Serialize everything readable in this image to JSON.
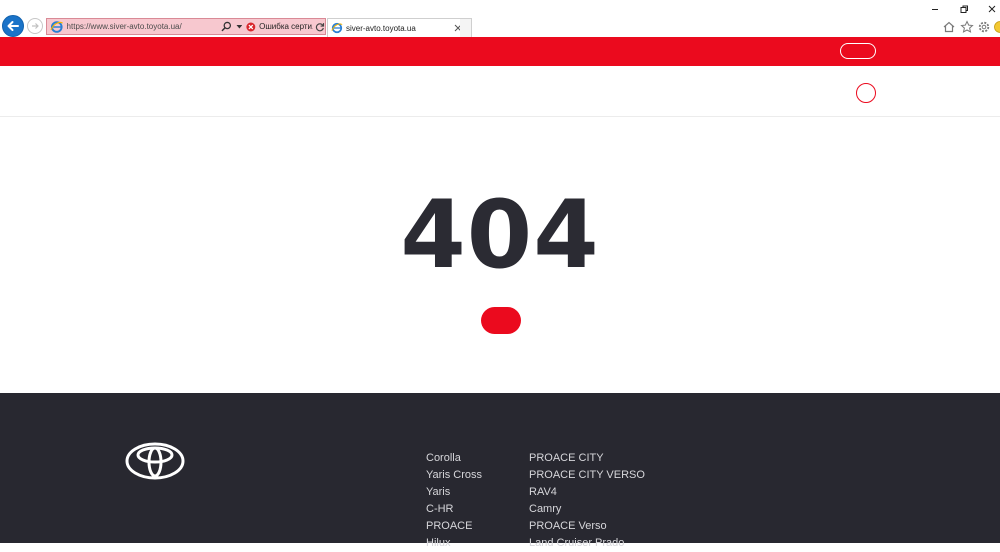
{
  "browser": {
    "address_url": "https://www.siver-avto.toyota.ua/",
    "cert_error_label": "Ошибка серти...",
    "tab_title": "siver-avto.toyota.ua"
  },
  "main": {
    "error_code": "404"
  },
  "footer": {
    "models_col1": [
      "Corolla",
      "Yaris Cross",
      "Yaris",
      "C-HR",
      "PROACE",
      "Hilux"
    ],
    "models_col2": [
      "PROACE CITY",
      "PROACE CITY VERSO",
      "RAV4",
      "Camry",
      "PROACE Verso",
      "Land Cruiser Prado"
    ]
  },
  "colors": {
    "brand_red": "#eb0a1e",
    "footer_bg": "#282830",
    "error_text": "#2b2b33"
  }
}
